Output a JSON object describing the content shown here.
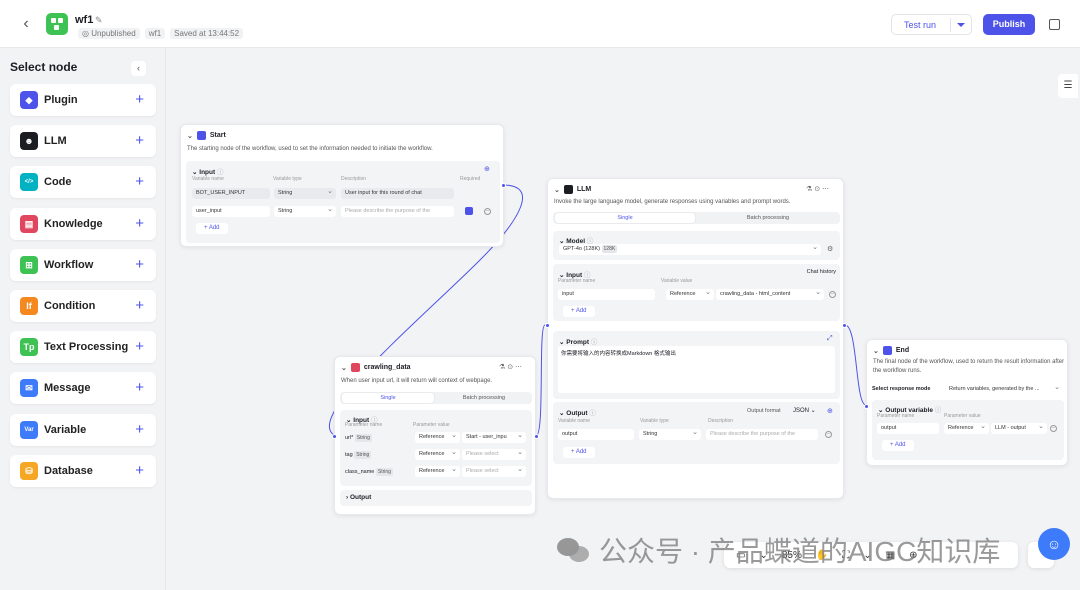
{
  "header": {
    "workflow_name": "wf1",
    "status": "Unpublished",
    "tag": "wf1",
    "saved": "Saved at 13:44:52",
    "test_run": "Test run",
    "publish": "Publish"
  },
  "sidebar": {
    "title": "Select node",
    "items": [
      {
        "label": "Plugin",
        "icon": "plugin-icon",
        "color": "#4d53e8"
      },
      {
        "label": "LLM",
        "icon": "llm-icon",
        "color": "#1c1d23"
      },
      {
        "label": "Code",
        "icon": "code-icon",
        "color": "#00b2c2"
      },
      {
        "label": "Knowledge",
        "icon": "knowledge-icon",
        "color": "#e0465e"
      },
      {
        "label": "Workflow",
        "icon": "workflow-icon",
        "color": "#3ec254"
      },
      {
        "label": "Condition",
        "icon": "condition-icon",
        "color": "#f5891f"
      },
      {
        "label": "Text Processing",
        "icon": "text-processing-icon",
        "color": "#3ec254"
      },
      {
        "label": "Message",
        "icon": "message-icon",
        "color": "#3e7bfa"
      },
      {
        "label": "Variable",
        "icon": "variable-icon",
        "color": "#3e7bfa"
      },
      {
        "label": "Database",
        "icon": "database-icon",
        "color": "#f5a623"
      }
    ]
  },
  "start_node": {
    "title": "Start",
    "desc": "The starting node of the workflow, used to set the information needed to initiate the workflow.",
    "input_title": "Input",
    "col_name": "Variable name",
    "col_type": "Variable type",
    "col_desc": "Description",
    "col_req": "Required",
    "rows": [
      {
        "name": "BOT_USER_INPUT",
        "type": "String",
        "desc": "User input for this round of chat"
      },
      {
        "name": "user_input",
        "type": "String",
        "desc": "Please describe the purpose of the"
      }
    ],
    "add": "Add"
  },
  "crawl_node": {
    "title": "crawling_data",
    "desc": "When user input url, it will return will context of webpage.",
    "tab_single": "Single",
    "tab_batch": "Batch processing",
    "input_title": "Input",
    "col_name": "Parameter name",
    "col_value": "Parameter value",
    "rows": [
      {
        "name": "url*",
        "type": "String",
        "mode": "Reference",
        "value": "Start - user_inpu"
      },
      {
        "name": "tag",
        "type": "String",
        "mode": "Reference",
        "value": "Please select"
      },
      {
        "name": "class_name",
        "type": "String",
        "mode": "Reference",
        "value": "Please select"
      }
    ],
    "output_title": "Output"
  },
  "llm_node": {
    "title": "LLM",
    "desc": "Invoke the large language model, generate responses using variables and prompt words.",
    "tab_single": "Single",
    "tab_batch": "Batch processing",
    "model_title": "Model",
    "model_name": "GPT-4o (128K)",
    "model_tag": "128K",
    "input_title": "Input",
    "chat_history": "Chat history",
    "col_name": "Parameter name",
    "col_value": "Variable value",
    "input_name": "input",
    "input_mode": "Reference",
    "input_value": "crawling_data - html_content",
    "add": "Add",
    "prompt_title": "Prompt",
    "prompt_text": "你需要将输入的内容转换成Markdown 格式输出",
    "output_title": "Output",
    "output_format_label": "Output format",
    "output_format": "JSON",
    "out_col_name": "Variable name",
    "out_col_type": "Variable type",
    "out_col_desc": "Description",
    "output_name": "output",
    "output_type": "String",
    "output_desc": "Please describe the purpose of the",
    "add2": "Add"
  },
  "end_node": {
    "title": "End",
    "desc": "The final node of the workflow, used to return the result information after the workflow runs.",
    "resp_label": "Select response mode",
    "resp_value": "Return variables, generated by the ...",
    "output_title": "Output variable",
    "col_name": "Parameter name",
    "col_value": "Parameter value",
    "var_name": "output",
    "var_mode": "Reference",
    "var_value": "LLM - output",
    "add": "Add"
  },
  "bottom": {
    "zoom": "85%"
  },
  "watermark": "公众号 · 产品蝶道的AIGC知识库"
}
